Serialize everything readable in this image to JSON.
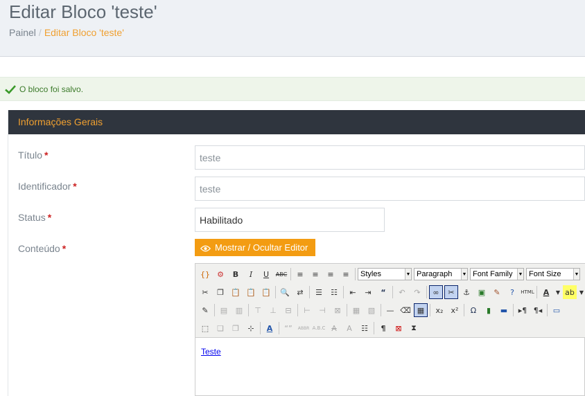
{
  "header": {
    "title": "Editar Bloco 'teste'",
    "breadcrumb_root": "Painel",
    "breadcrumb_sep": "/",
    "breadcrumb_current": "Editar Bloco 'teste'"
  },
  "alert": {
    "message": "O bloco foi salvo.",
    "color": "#3b7a2a"
  },
  "panel": {
    "heading": "Informações Gerais"
  },
  "form": {
    "title_label": "Título",
    "identifier_label": "Identificador",
    "status_label": "Status",
    "content_label": "Conteúdo",
    "required_mark": "*",
    "title_value": "teste",
    "identifier_value": "teste",
    "status_value": "Habilitado"
  },
  "editor": {
    "toggle_label": "Mostrar / Ocultar Editor",
    "styles": "Styles",
    "format": "Paragraph",
    "font_family": "Font Family",
    "font_size": "Font Size",
    "content_link": "Teste",
    "abbr_label": "ABBR"
  },
  "colors": {
    "accent": "#f39c12",
    "heading_bg": "#2f353e",
    "heading_text": "#f0a030",
    "required": "#cc2222"
  }
}
